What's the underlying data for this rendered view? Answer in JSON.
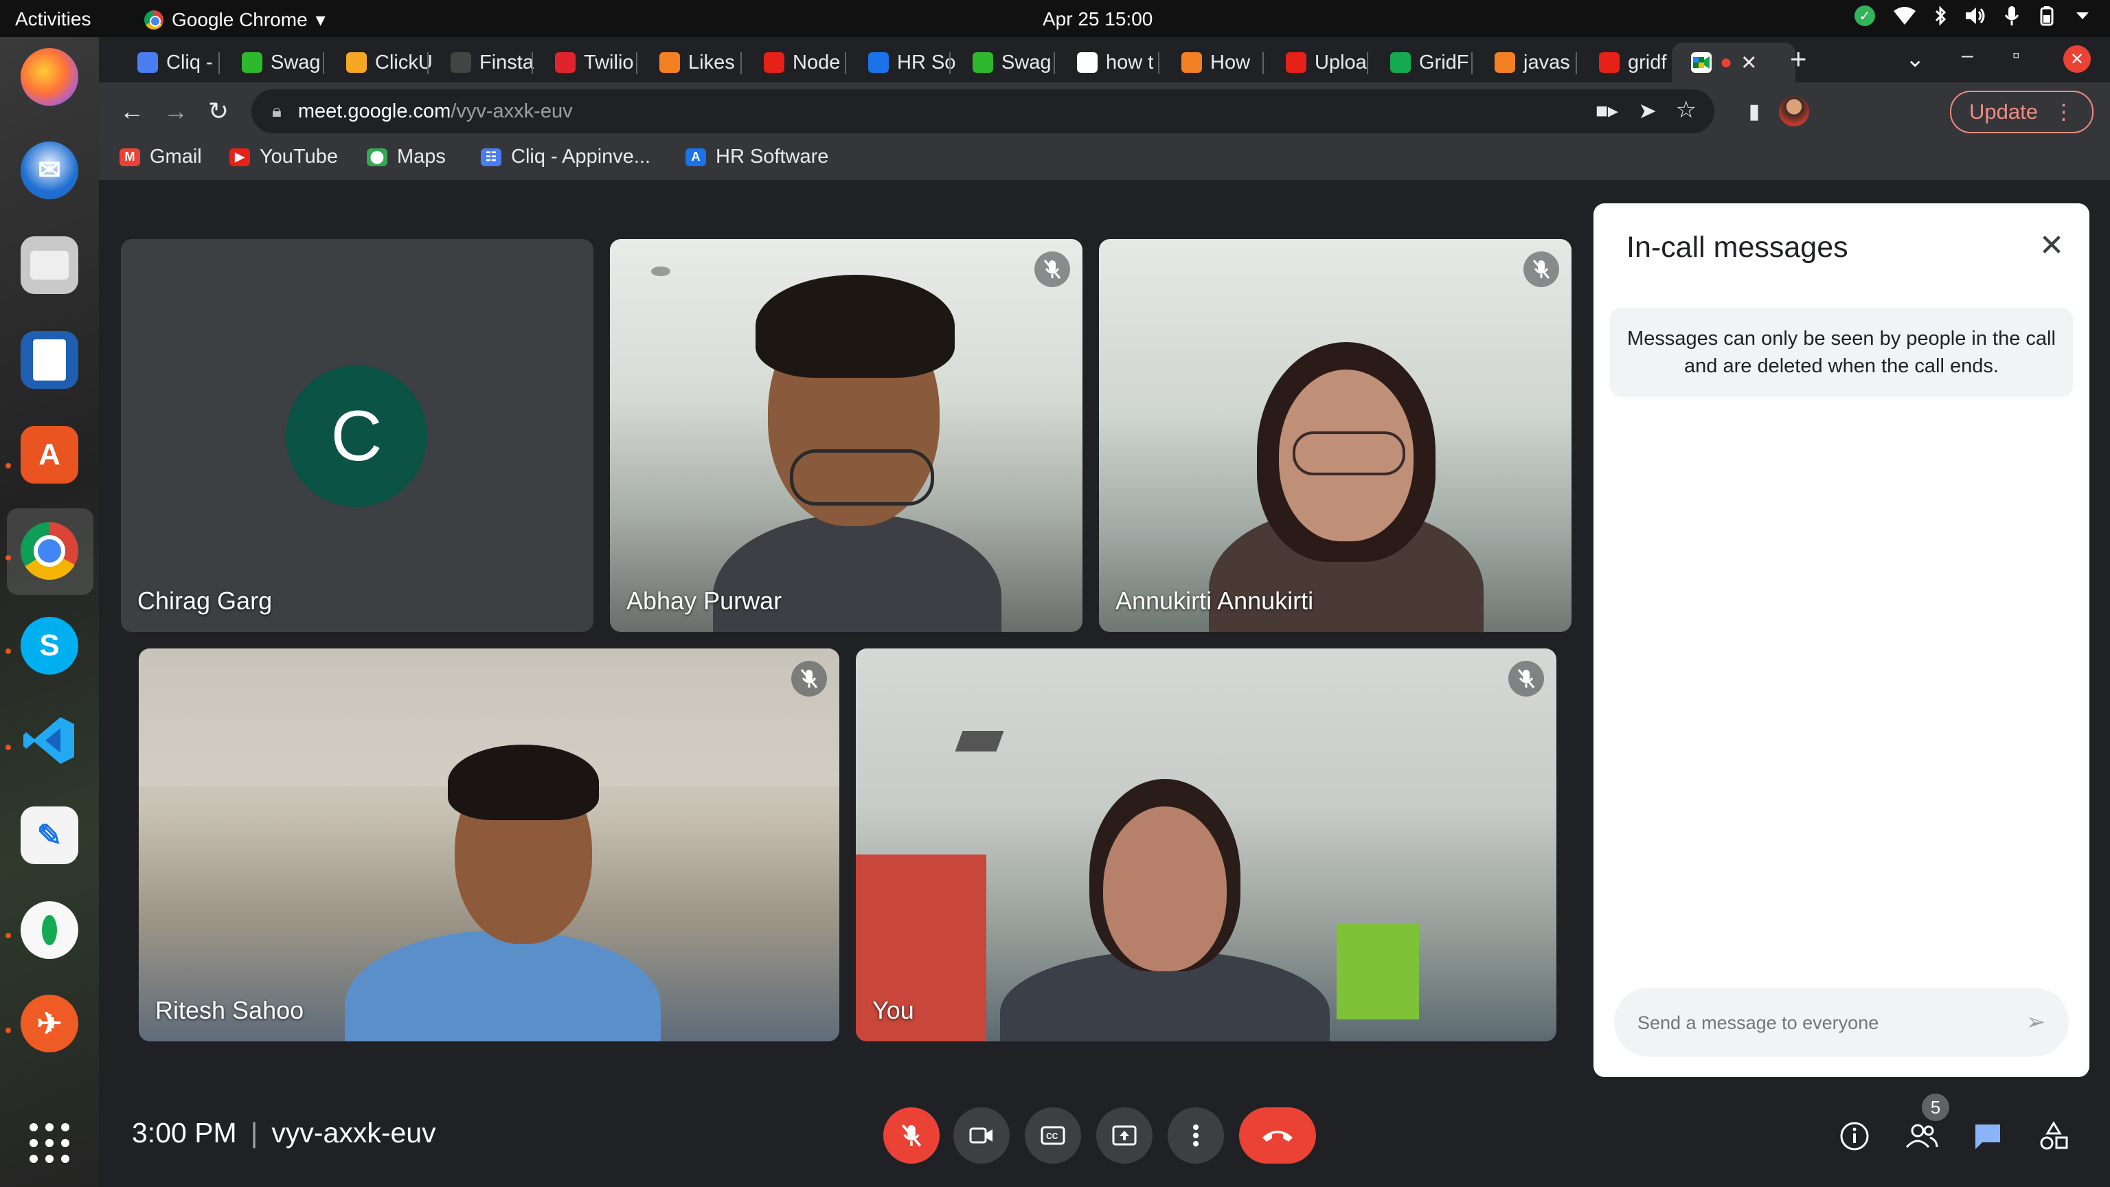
{
  "system_bar": {
    "activities": "Activities",
    "app_name": "Google Chrome",
    "app_menu_arrow": "▾",
    "datetime": "Apr 25  15:00"
  },
  "dock": {
    "icons": [
      "firefox-icon",
      "thunderbird-icon",
      "files-icon",
      "libreoffice-writer-icon",
      "app-center-icon",
      "chrome-icon",
      "skype-icon",
      "vscode-icon",
      "text-editor-icon",
      "mongodb-compass-icon",
      "postman-icon",
      "show-apps-icon"
    ]
  },
  "tabs": [
    {
      "label": "Cliq -",
      "color": "#4a7df0"
    },
    {
      "label": "Swag",
      "color": "#2eb82e"
    },
    {
      "label": "ClickU",
      "color": "#f5a623"
    },
    {
      "label": "Finsta",
      "color": "#444444"
    },
    {
      "label": "Twilio",
      "color": "#e0242d"
    },
    {
      "label": "Likes",
      "color": "#f48024"
    },
    {
      "label": "Node",
      "color": "#e62117"
    },
    {
      "label": "HR So",
      "color": "#1a73e8"
    },
    {
      "label": "Swag",
      "color": "#2eb82e"
    },
    {
      "label": "how t",
      "color": "#ffffff"
    },
    {
      "label": "How",
      "color": "#f48024"
    },
    {
      "label": "Uploa",
      "color": "#e62117"
    },
    {
      "label": "GridF",
      "color": "#13aa52"
    },
    {
      "label": "javas",
      "color": "#f48024"
    },
    {
      "label": "gridf",
      "color": "#e62117"
    }
  ],
  "active_tab": {
    "recording_dot": "●",
    "close": "✕"
  },
  "new_tab_label": "+",
  "window_controls": {
    "tab_search": "⌄",
    "minimize": "–",
    "restore": "▫",
    "close": "✕"
  },
  "address_bar": {
    "host": "meet.google.com",
    "path": "/vyv-axxk-euv"
  },
  "update_button": {
    "label": "Update",
    "menu": "⋮"
  },
  "bookmarks": [
    {
      "label": "Gmail",
      "icon": "gmail-icon",
      "color": "#ea4335",
      "glyph": "M"
    },
    {
      "label": "YouTube",
      "icon": "youtube-icon",
      "color": "#e62117",
      "glyph": "▶"
    },
    {
      "label": "Maps",
      "icon": "maps-icon",
      "color": "#34a853",
      "glyph": "⬤"
    },
    {
      "label": "Cliq - Appinve...",
      "icon": "cliq-icon",
      "color": "#4a7df0",
      "glyph": "☷"
    },
    {
      "label": "HR Software",
      "icon": "hr-software-icon",
      "color": "#1a73e8",
      "glyph": "A"
    }
  ],
  "participants": [
    {
      "name": "Chirag Garg",
      "initial": "C",
      "muted": false
    },
    {
      "name": "Abhay Purwar",
      "muted": true
    },
    {
      "name": "Annukirti Annukirti",
      "muted": true
    },
    {
      "name": "Ritesh Sahoo",
      "muted": true
    },
    {
      "name": "You",
      "muted": true
    }
  ],
  "chat_panel": {
    "title": "In-call messages",
    "notice": "Messages can only be seen by people in the call and are deleted when the call ends.",
    "input_placeholder": "Send a message to everyone"
  },
  "meeting": {
    "time": "3:00 PM",
    "divider": "|",
    "code": "vyv-axxk-euv"
  },
  "people_count": "5",
  "colors": {
    "meet_background": "#202124",
    "end_call": "#ea4335",
    "avatar": "#0b5345",
    "chat_accent": "#1a73e8"
  }
}
